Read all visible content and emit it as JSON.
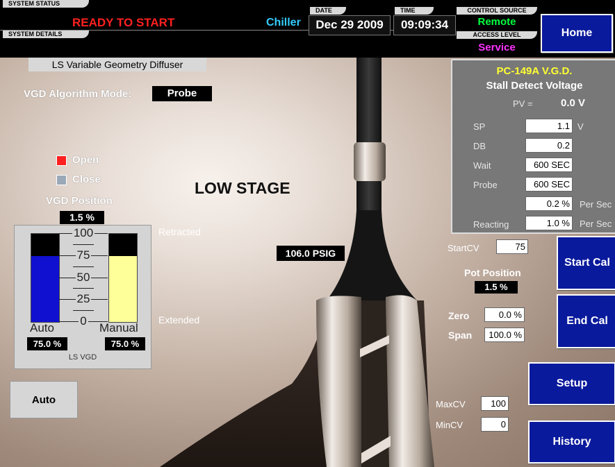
{
  "header": {
    "system_status_label": "SYSTEM STATUS",
    "system_status": "READY TO START",
    "chiller": "Chiller",
    "system_details_label": "SYSTEM DETAILS",
    "date_label": "DATE",
    "date": "Dec 29 2009",
    "time_label": "TIME",
    "time": "09:09:34",
    "control_source_label": "CONTROL SOURCE",
    "control_source": "Remote",
    "access_level_label": "ACCESS LEVEL",
    "access_level": "Service"
  },
  "nav": {
    "home": "Home",
    "start_cal": "Start Cal",
    "end_cal": "End Cal",
    "setup": "Setup",
    "history": "History"
  },
  "page": {
    "title": "LS Variable Geometry Diffuser",
    "mode_label": "VGD Algorithm Mode:",
    "mode_value": "Probe",
    "stage": "LOW STAGE",
    "pressure": "106.0 PSIG",
    "retracted": "Retracted",
    "extended": "Extended"
  },
  "legend": {
    "open": "Open",
    "close": "Close",
    "open_color": "#ff2020",
    "close_color": "#9aa8b8"
  },
  "vgd_position": {
    "label": "VGD Position",
    "value": "1.5 %"
  },
  "gauge": {
    "ticks": [
      "100",
      "75",
      "50",
      "25",
      "0"
    ],
    "auto_label": "Auto",
    "manual_label": "Manual",
    "auto_value": "75.0 %",
    "manual_value": "75.0 %",
    "auto_level": 0.75,
    "manual_level": 0.75,
    "caption": "LS VGD",
    "auto_color": "#1010d0",
    "manual_color": "#ffff99"
  },
  "auto_button": "Auto",
  "stall_panel": {
    "title": "PC-149A V.G.D.",
    "subtitle": "Stall Detect Voltage",
    "pv_label": "PV =",
    "pv_value": "0.0 V",
    "sp_label": "SP",
    "sp_value": "1.1",
    "sp_unit": "V",
    "db_label": "DB",
    "db_value": "0.2",
    "wait_label": "Wait",
    "wait_value": "600 SEC",
    "probe_label": "Probe",
    "probe_value": "600 SEC",
    "probe_rate_value": "0.2 %",
    "per_sec_1": "Per Sec",
    "reacting_label": "Reacting",
    "reacting_value": "1.0 %",
    "per_sec_2": "Per Sec"
  },
  "calibration": {
    "startcv_label": "StartCV",
    "startcv_value": "75",
    "pot_label": "Pot Position",
    "pot_value": "1.5 %",
    "zero_label": "Zero",
    "zero_value": "0.0 %",
    "span_label": "Span",
    "span_value": "100.0 %",
    "maxcv_label": "MaxCV",
    "maxcv_value": "100",
    "mincv_label": "MinCV",
    "mincv_value": "0"
  }
}
